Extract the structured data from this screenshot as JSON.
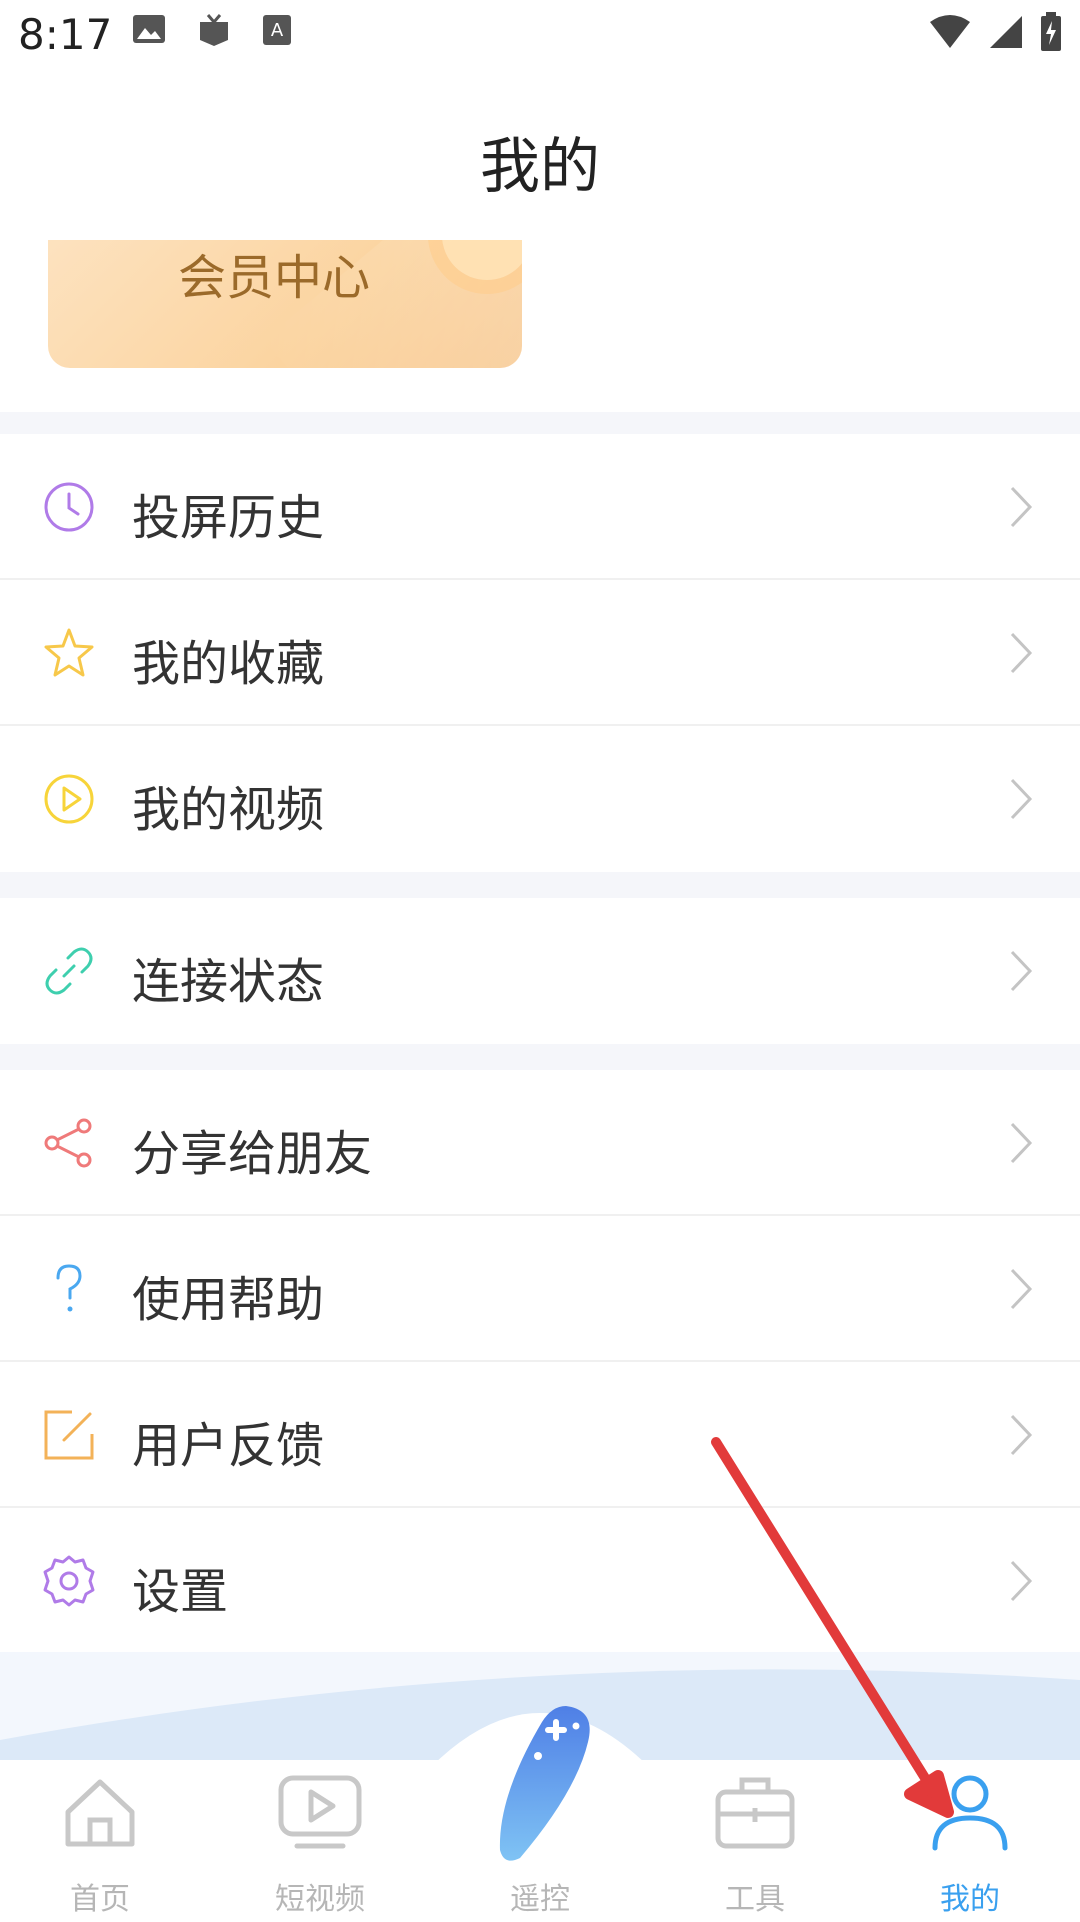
{
  "status_bar": {
    "time": "8:17"
  },
  "header": {
    "title": "我的"
  },
  "member_card": {
    "label": "会员中心"
  },
  "menu": [
    {
      "id": "history",
      "label": "投屏历史",
      "icon": "clock-icon",
      "color": "#b07be8"
    },
    {
      "id": "favorites",
      "label": "我的收藏",
      "icon": "star-icon",
      "color": "#f7c84a"
    },
    {
      "id": "videos",
      "label": "我的视频",
      "icon": "play-circle-icon",
      "color": "#f7d43a"
    },
    {
      "id": "connection",
      "label": "连接状态",
      "icon": "link-icon",
      "color": "#3ecfae"
    },
    {
      "id": "share",
      "label": "分享给朋友",
      "icon": "share-icon",
      "color": "#ef7a7a"
    },
    {
      "id": "help",
      "label": "使用帮助",
      "icon": "question-icon",
      "color": "#4aa8f0"
    },
    {
      "id": "feedback",
      "label": "用户反馈",
      "icon": "edit-icon",
      "color": "#f3b258"
    },
    {
      "id": "settings",
      "label": "设置",
      "icon": "gear-icon",
      "color": "#b07be8"
    }
  ],
  "tabbar": {
    "items": [
      {
        "label": "首页",
        "icon": "home-icon",
        "active": false
      },
      {
        "label": "短视频",
        "icon": "tv-play-icon",
        "active": false
      },
      {
        "label": "遥控",
        "icon": "remote-icon",
        "active": false
      },
      {
        "label": "工具",
        "icon": "toolbox-icon",
        "active": false
      },
      {
        "label": "我的",
        "icon": "user-icon",
        "active": true
      }
    ],
    "active_color": "#3aa0ef",
    "inactive_color": "#b6b6b6"
  }
}
